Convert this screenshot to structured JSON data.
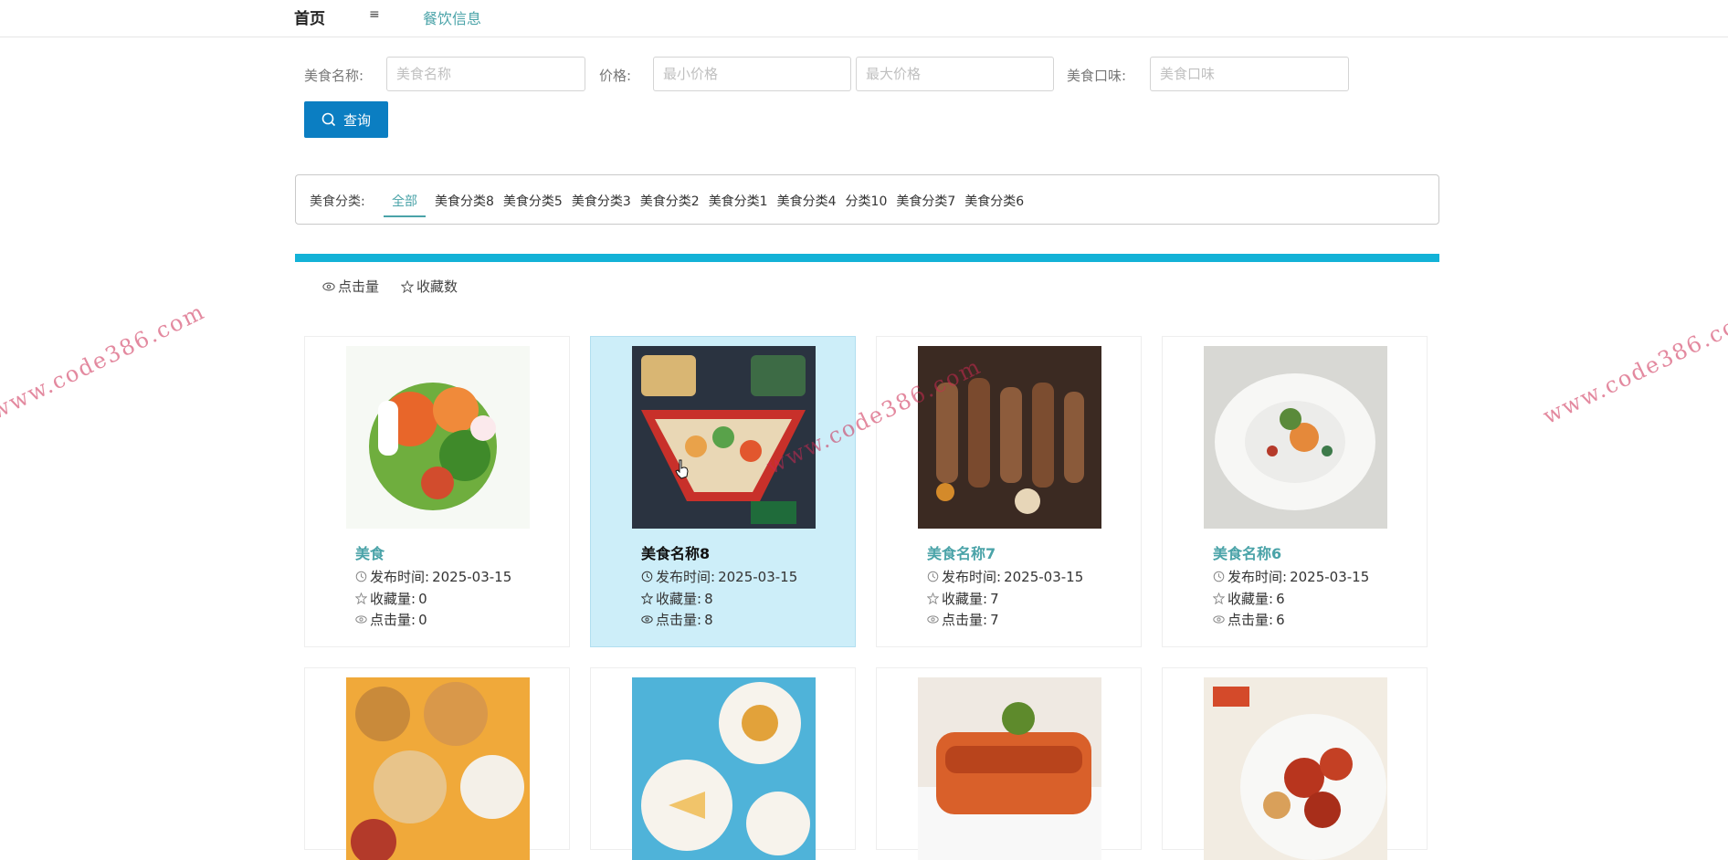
{
  "nav": {
    "home": "首页",
    "menu_icon": "≡",
    "food_info": "餐饮信息"
  },
  "search": {
    "name_label": "美食名称:",
    "name_placeholder": "美食名称",
    "price_label": "价格:",
    "min_price_placeholder": "最小价格",
    "max_price_placeholder": "最大价格",
    "taste_label": "美食口味:",
    "taste_placeholder": "美食口味",
    "button_label": "查询"
  },
  "categories": {
    "label": "美食分类:",
    "items": [
      "全部",
      "美食分类8",
      "美食分类5",
      "美食分类3",
      "美食分类2",
      "美食分类1",
      "美食分类4",
      "分类10",
      "美食分类7",
      "美食分类6"
    ]
  },
  "sort": {
    "clicks": "点击量",
    "favorites": "收藏数"
  },
  "meta_labels": {
    "publish": "发布时间:",
    "favorites": "收藏量:",
    "clicks": "点击量:"
  },
  "cards": [
    {
      "name": "美食",
      "date": "2025-03-15",
      "favorites": "0",
      "clicks": "0"
    },
    {
      "name": "美食名称8",
      "date": "2025-03-15",
      "favorites": "8",
      "clicks": "8"
    },
    {
      "name": "美食名称7",
      "date": "2025-03-15",
      "favorites": "7",
      "clicks": "7"
    },
    {
      "name": "美食名称6",
      "date": "2025-03-15",
      "favorites": "6",
      "clicks": "6"
    }
  ],
  "watermark": "www.code386.com",
  "colors": {
    "accent": "#4aa3a8",
    "button": "#0b7ec2",
    "bar": "#13b2d7",
    "highlight": "#cdeef9"
  }
}
